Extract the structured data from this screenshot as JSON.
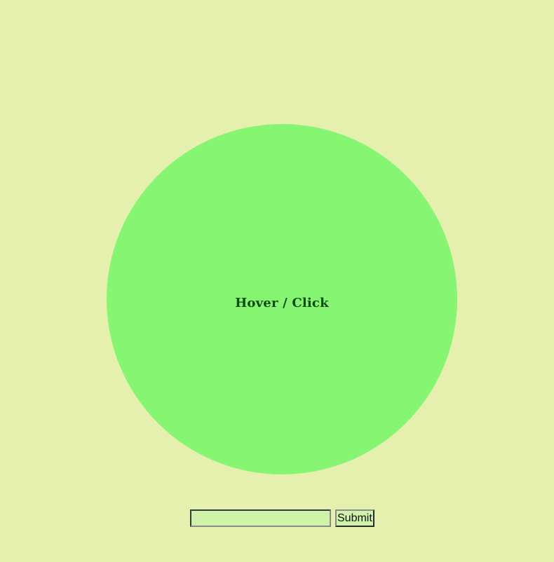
{
  "circle": {
    "label": "Hover / Click",
    "color": "#86f672"
  },
  "form": {
    "input_value": "",
    "input_placeholder": "",
    "submit_label": "Submit"
  },
  "colors": {
    "background": "#e5f0ae",
    "input_background": "#cef3a9",
    "label_text": "#0b4a0b"
  }
}
